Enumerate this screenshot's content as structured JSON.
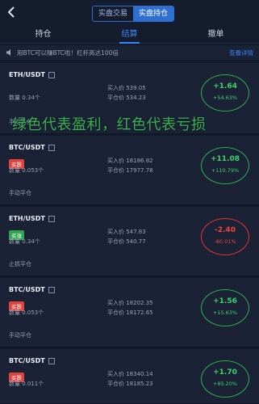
{
  "header": {
    "segments": [
      {
        "label": "实盘交易",
        "active": false
      },
      {
        "label": "实盘持仓",
        "active": true
      }
    ]
  },
  "tabs": [
    {
      "label": "持仓",
      "active": false
    },
    {
      "label": "结算",
      "active": true
    },
    {
      "label": "撤单",
      "active": false
    }
  ],
  "notice": {
    "text": "用BTC可以赚BTC啦！杠杆高达100倍",
    "more": "查看详情"
  },
  "annotation": "绿色代表盈利，红色代表亏损",
  "colors": {
    "profit": "#3dd36a",
    "loss": "#f0463c",
    "badge_red": "#e0433c",
    "badge_green": "#2fa64e",
    "ring_green": "#2bb34a",
    "ring_red": "#e0372f"
  },
  "records": [
    {
      "pair": "ETH/USDT",
      "badge": "",
      "badge_type": "",
      "qty": "数量 0.34个",
      "buy": "买入价 539.05",
      "sell": "平仓价 534.23",
      "pnl": "+1.64",
      "pct": "+54.63%",
      "close": "手动平仓",
      "status": "profit"
    },
    {
      "pair": "BTC/USDT",
      "badge": "买跌",
      "badge_type": "red",
      "qty": "数量 0.053个",
      "buy": "买入价 18186.82",
      "sell": "平仓价 17977.78",
      "pnl": "+11.08",
      "pct": "+110.79%",
      "close": "手动平仓",
      "status": "profit"
    },
    {
      "pair": "ETH/USDT",
      "badge": "买涨",
      "badge_type": "green",
      "qty": "数量 0.34个",
      "buy": "买入价 547.83",
      "sell": "平仓价 540.77",
      "pnl": "-2.40",
      "pct": "-80.01%",
      "close": "止损平仓",
      "status": "loss"
    },
    {
      "pair": "BTC/USDT",
      "badge": "买跌",
      "badge_type": "red",
      "qty": "数量 0.053个",
      "buy": "买入价 18202.35",
      "sell": "平仓价 18172.65",
      "pnl": "+1.56",
      "pct": "+15.63%",
      "close": "手动平仓",
      "status": "profit"
    },
    {
      "pair": "BTC/USDT",
      "badge": "买跌",
      "badge_type": "red",
      "qty": "数量 0.011个",
      "buy": "买入价 18340.14",
      "sell": "平仓价 18185.23",
      "pnl": "+1.70",
      "pct": "+85.20%",
      "close": "",
      "status": "profit"
    }
  ]
}
